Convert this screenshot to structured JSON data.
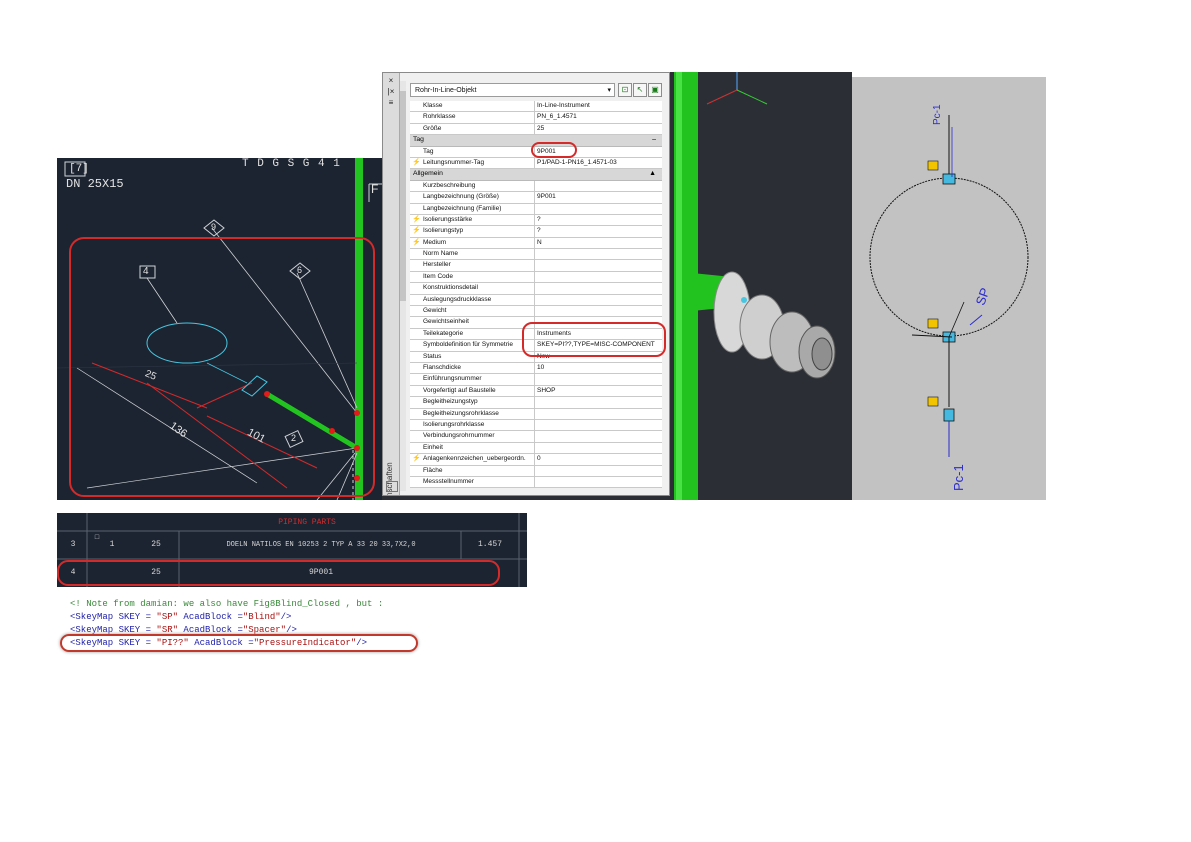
{
  "iso_drawing": {
    "header_line1": "[7]",
    "header_line2": "DN 25X15",
    "top_label": "T D  G S  G  4  1",
    "right_label": "F",
    "tag_4": "4",
    "tag_9": "9",
    "tag_6": "6",
    "tag_2": "2",
    "dim_25": "25",
    "dim_136": "136",
    "dim_101": "101"
  },
  "viewport_3d": {
    "description_colors": {
      "pipe": "#22c41f",
      "background": "#2b2f35"
    }
  },
  "palette": {
    "close_button": "×",
    "pin_button": "|×",
    "props_button": "≡",
    "vertical_title": "Eigenschaften",
    "object_type": "Rohr-In-Line-Objekt",
    "rows": [
      {
        "kind": "row",
        "label": "Klasse",
        "value": "In-Line-Instrument",
        "bolt": false
      },
      {
        "kind": "row",
        "label": "Rohrklasse",
        "value": "PN_6_1.4571",
        "bolt": false
      },
      {
        "kind": "row",
        "label": "Größe",
        "value": "25",
        "bolt": false
      },
      {
        "kind": "section",
        "label": "Tag",
        "toggle": "–"
      },
      {
        "kind": "row",
        "label": "Tag",
        "value": "9P001",
        "bolt": false
      },
      {
        "kind": "row",
        "label": "Leitungsnummer-Tag",
        "value": "P1/PAD-1-PN16_1.4571-03",
        "bolt": true
      },
      {
        "kind": "section",
        "label": "Allgemein",
        "toggle": "▲"
      },
      {
        "kind": "row",
        "label": "Kurzbeschreibung",
        "value": "",
        "bolt": false
      },
      {
        "kind": "row",
        "label": "Langbezeichnung (Größe)",
        "value": "9P001",
        "bolt": false
      },
      {
        "kind": "row",
        "label": "Langbezeichnung (Familie)",
        "value": "",
        "bolt": false
      },
      {
        "kind": "row",
        "label": "Isolierungsstärke",
        "value": "?",
        "bolt": true
      },
      {
        "kind": "row",
        "label": "Isolierungstyp",
        "value": "?",
        "bolt": true
      },
      {
        "kind": "row",
        "label": "Medium",
        "value": "N",
        "bolt": true
      },
      {
        "kind": "row",
        "label": "Norm Name",
        "value": "",
        "bolt": false
      },
      {
        "kind": "row",
        "label": "Hersteller",
        "value": "",
        "bolt": false
      },
      {
        "kind": "row",
        "label": "Item Code",
        "value": "",
        "bolt": false
      },
      {
        "kind": "row",
        "label": "Konstruktionsdetail",
        "value": "",
        "bolt": false
      },
      {
        "kind": "row",
        "label": "Auslegungsdruckklasse",
        "value": "",
        "bolt": false
      },
      {
        "kind": "row",
        "label": "Gewicht",
        "value": "",
        "bolt": false
      },
      {
        "kind": "row",
        "label": "Gewichtseinheit",
        "value": "",
        "bolt": false
      },
      {
        "kind": "row",
        "label": "Teilekategorie",
        "value": "Instruments",
        "bolt": false
      },
      {
        "kind": "row",
        "label": "Symboldefinition für Symmetrie",
        "value": "SKEY=PI??,TYPE=MISC-COMPONENT",
        "bolt": false
      },
      {
        "kind": "row",
        "label": "Status",
        "value": "New",
        "bolt": false
      },
      {
        "kind": "row",
        "label": "Flanschdicke",
        "value": "10",
        "bolt": false
      },
      {
        "kind": "row",
        "label": "Einführungsnummer",
        "value": "",
        "bolt": false
      },
      {
        "kind": "row",
        "label": "Vorgefertigt auf Baustelle",
        "value": "SHOP",
        "bolt": false
      },
      {
        "kind": "row",
        "label": "Begleitheizungstyp",
        "value": "",
        "bolt": false
      },
      {
        "kind": "row",
        "label": "Begleitheizungsrohrklasse",
        "value": "",
        "bolt": false
      },
      {
        "kind": "row",
        "label": "Isolierungsrohrklasse",
        "value": "",
        "bolt": false
      },
      {
        "kind": "row",
        "label": "Verbindungsrohrnummer",
        "value": "",
        "bolt": false
      },
      {
        "kind": "row",
        "label": "Einheit",
        "value": "",
        "bolt": false
      },
      {
        "kind": "row",
        "label": "Anlagenkennzeichen_uebergeordn.",
        "value": "0",
        "bolt": true
      },
      {
        "kind": "row",
        "label": "Fläche",
        "value": "",
        "bolt": false
      },
      {
        "kind": "row",
        "label": "Messstellnummer",
        "value": "",
        "bolt": false
      }
    ]
  },
  "symbol_view": {
    "label_top": "Pc-1",
    "label_sp": "SP",
    "label_bottom": "Pc-1"
  },
  "bom": {
    "header": "PIPING PARTS",
    "row1": {
      "pos": "3",
      "mark": "□",
      "qty": "1",
      "size": "25",
      "desc": "DOELN NATILOS EN 10253 2 TYP A 33 20 33,7X2,0",
      "value": "1.457"
    },
    "row2": {
      "pos": "4",
      "size": "25",
      "desc": "9P001"
    }
  },
  "xml": {
    "line1": "<!   Note from damian: we also have Fig8Blind_Closed , but :",
    "line2_tag": "<SkeyMap SKEY = ",
    "line2_skey": "\"SP\"",
    "line2_mid": " AcadBlock =",
    "line2_block": "\"Blind\"",
    "line2_end": "/>",
    "line3_tag": "<SkeyMap SKEY = ",
    "line3_skey": "\"SR\"",
    "line3_mid": " AcadBlock =",
    "line3_block": "\"Spacer\"",
    "line3_end": "/>",
    "line4_tag": "<SkeyMap SKEY = ",
    "line4_skey": "\"PI??\"",
    "line4_mid": " AcadBlock =",
    "line4_block": "\"PressureIndicator\"",
    "line4_end": "/>"
  },
  "colors": {
    "highlight": "#d42a2a",
    "pipe_green": "#22c41f",
    "cad_bg": "#1d2431",
    "xml_comment": "#3a8a3a",
    "xml_tag": "#2222aa",
    "xml_attr": "#a11111"
  }
}
